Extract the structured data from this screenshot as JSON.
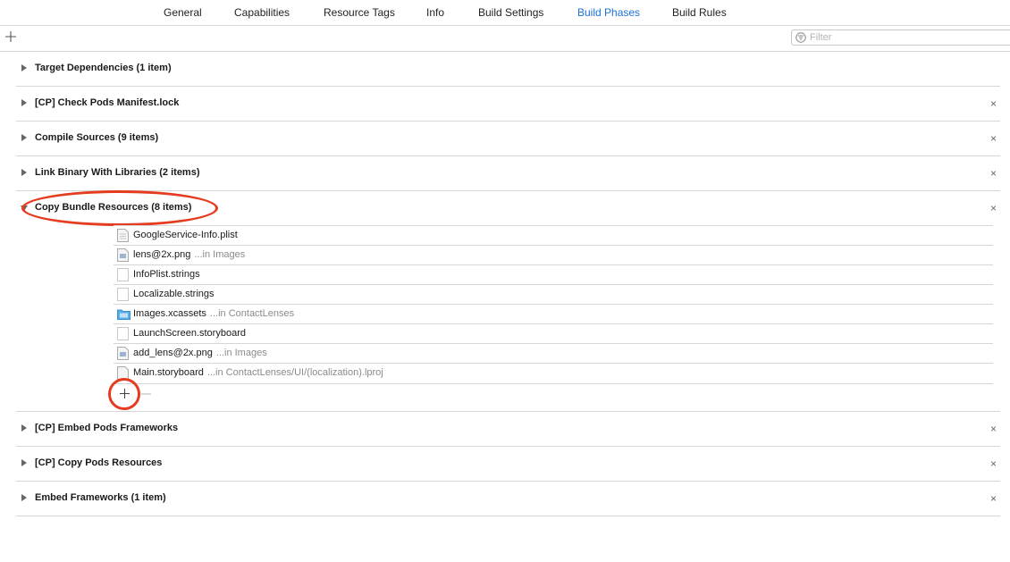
{
  "tabs": [
    {
      "label": "General"
    },
    {
      "label": "Capabilities"
    },
    {
      "label": "Resource Tags"
    },
    {
      "label": "Info"
    },
    {
      "label": "Build Settings"
    },
    {
      "label": "Build Phases",
      "active": true
    },
    {
      "label": "Build Rules"
    }
  ],
  "toolbar": {
    "add_icon": "plus-icon",
    "filter_placeholder": "Filter",
    "filter_icon": "filter-icon"
  },
  "phases": {
    "target_dependencies": "Target Dependencies (1 item)",
    "check_pods_manifest": "[CP] Check Pods Manifest.lock",
    "compile_sources": "Compile Sources (9 items)",
    "link_binary": "Link Binary With Libraries (2 items)",
    "copy_bundle": "Copy Bundle Resources (8 items)",
    "embed_pods_frameworks": "[CP] Embed Pods Frameworks",
    "copy_pods_resources": "[CP] Copy Pods Resources",
    "embed_frameworks": "Embed Frameworks (1 item)",
    "close_symbol": "×"
  },
  "copy_bundle_files": [
    {
      "name": "GoogleService-Info.plist",
      "location": ""
    },
    {
      "name": "lens@2x.png",
      "location": "...in Images"
    },
    {
      "name": "InfoPlist.strings",
      "location": ""
    },
    {
      "name": "Localizable.strings",
      "location": ""
    },
    {
      "name": "Images.xcassets",
      "location": "...in ContactLenses"
    },
    {
      "name": "LaunchScreen.storyboard",
      "location": ""
    },
    {
      "name": "add_lens@2x.png",
      "location": "...in Images"
    },
    {
      "name": "Main.storyboard",
      "location": "...in ContactLenses/UI/(localization).lproj"
    }
  ],
  "colors": {
    "accent": "#1a73d9",
    "annotation": "#e53b1f",
    "folder": "#5aaee8"
  }
}
